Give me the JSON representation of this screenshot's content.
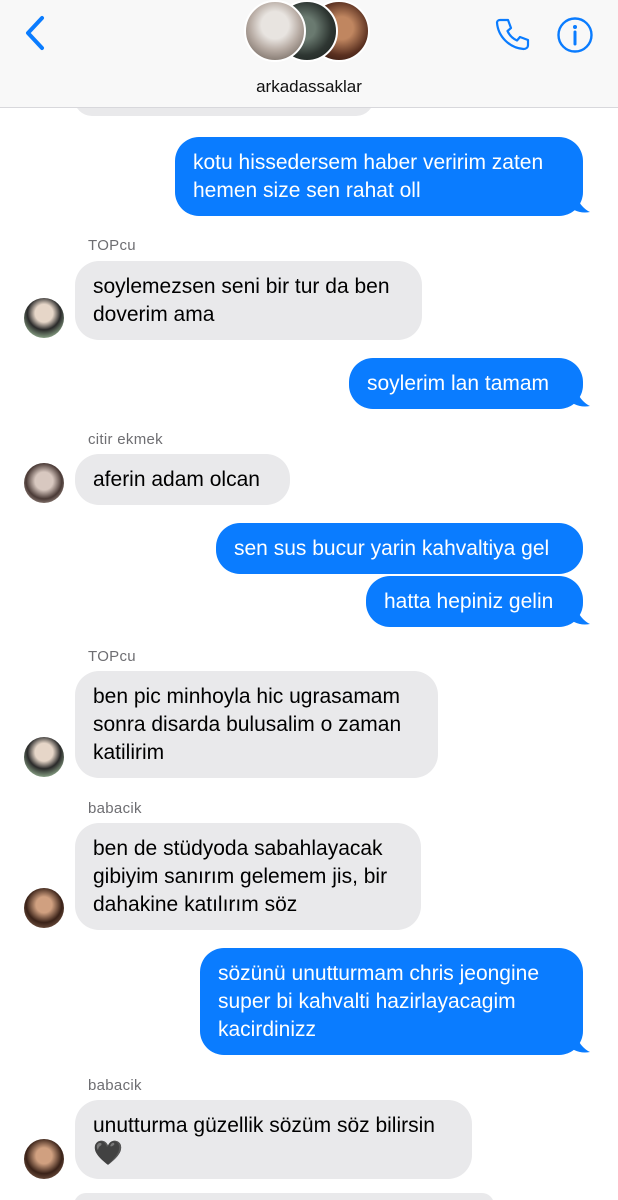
{
  "header": {
    "group_name": "arkadassaklar"
  },
  "icons": {
    "back": "chevron-left-icon",
    "phone": "phone-icon",
    "info": "info-icon"
  },
  "colors": {
    "accent": "#0a7cff",
    "outgoing_bubble": "#0a7cff",
    "incoming_bubble": "#e9e9eb",
    "header_bg": "#f8f8f8"
  },
  "messages": [
    {
      "direction": "out",
      "lines": [
        "kotu hissedersem haber veririm zaten",
        "hemen size sen rahat oll"
      ]
    },
    {
      "direction": "in",
      "sender": "TOPcu",
      "lines": [
        "soylemezsen seni bir tur da ben",
        "doverim ama"
      ]
    },
    {
      "direction": "out",
      "lines": [
        "soylerim lan tamam"
      ]
    },
    {
      "direction": "in",
      "sender": "citir ekmek",
      "lines": [
        "aferin adam olcan"
      ]
    },
    {
      "direction": "out",
      "lines": [
        "sen sus bucur yarin kahvaltiya gel"
      ]
    },
    {
      "direction": "out",
      "lines": [
        "hatta hepiniz gelin"
      ]
    },
    {
      "direction": "in",
      "sender": "TOPcu",
      "lines": [
        "ben pic minhoyla hic ugrasamam",
        "sonra disarda bulusalim o zaman",
        "katilirim"
      ]
    },
    {
      "direction": "in",
      "sender": "babacik",
      "lines": [
        "ben de stüdyoda sabahlayacak",
        "gibiyim sanırım gelemem jis, bir",
        "dahakine katılırım söz"
      ]
    },
    {
      "direction": "out",
      "lines": [
        "sözünü unutturmam chris jeongine",
        "super bi kahvalti hazirlayacagim",
        "kacirdinizz"
      ]
    },
    {
      "direction": "in",
      "sender": "babacik",
      "lines": [
        "unutturma güzellik sözüm söz bilirsin",
        "🖤"
      ]
    }
  ]
}
